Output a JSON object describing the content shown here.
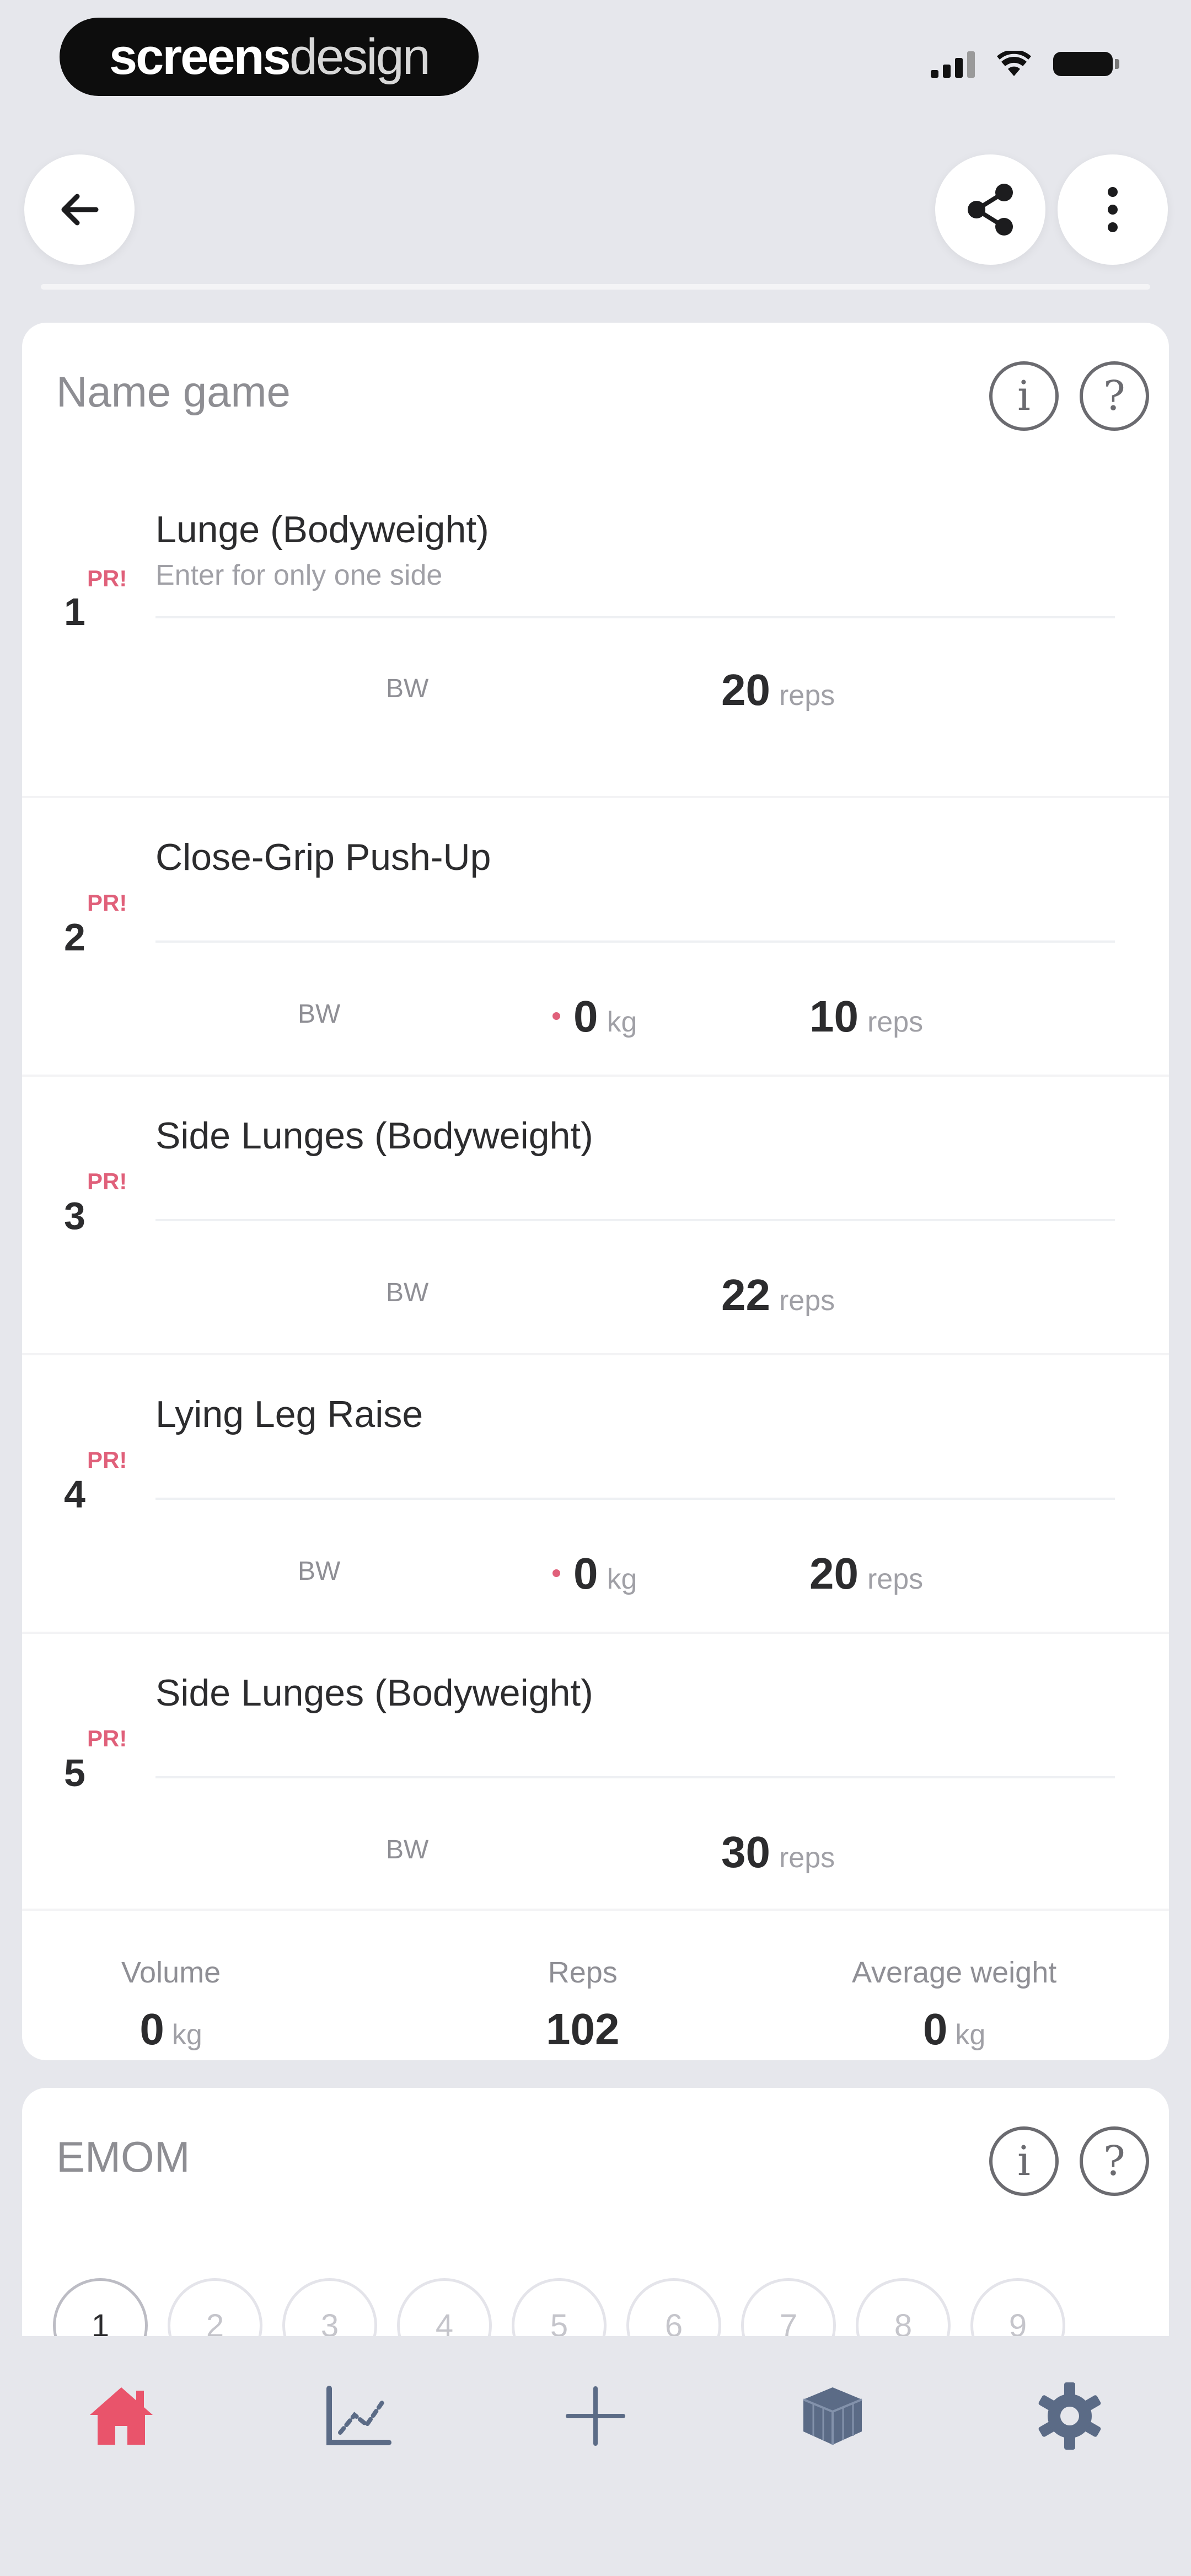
{
  "status_bar": {
    "brand_bold": "screens",
    "brand_light": "design"
  },
  "cards": [
    {
      "title": "Name game",
      "exercises": [
        {
          "number": "1",
          "pr": "PR!",
          "name": "Lunge (Bodyweight)",
          "note": "Enter for only one side",
          "bw": "BW",
          "reps_value": "20",
          "reps_unit": "reps"
        },
        {
          "number": "2",
          "pr": "PR!",
          "name": "Close-Grip Push-Up",
          "bw": "BW",
          "weight_value": "0",
          "weight_unit": "kg",
          "reps_value": "10",
          "reps_unit": "reps"
        },
        {
          "number": "3",
          "pr": "PR!",
          "name": "Side Lunges (Bodyweight)",
          "bw": "BW",
          "reps_value": "22",
          "reps_unit": "reps"
        },
        {
          "number": "4",
          "pr": "PR!",
          "name": "Lying Leg Raise",
          "bw": "BW",
          "weight_value": "0",
          "weight_unit": "kg",
          "reps_value": "20",
          "reps_unit": "reps"
        },
        {
          "number": "5",
          "pr": "PR!",
          "name": "Side Lunges (Bodyweight)",
          "bw": "BW",
          "reps_value": "30",
          "reps_unit": "reps"
        }
      ],
      "summary": {
        "volume_label": "Volume",
        "volume_value": "0",
        "volume_unit": "kg",
        "reps_label": "Reps",
        "reps_value": "102",
        "avg_label": "Average weight",
        "avg_value": "0",
        "avg_unit": "kg"
      }
    },
    {
      "title": "EMOM",
      "minutes": [
        "1",
        "2",
        "3",
        "4",
        "5",
        "6",
        "7",
        "8",
        "9"
      ]
    }
  ],
  "icons": {
    "info": "i",
    "help": "?"
  },
  "colors": {
    "accent": "#e9546b",
    "tab_inactive": "#5b6b86",
    "pr_red": "#e0607a"
  }
}
